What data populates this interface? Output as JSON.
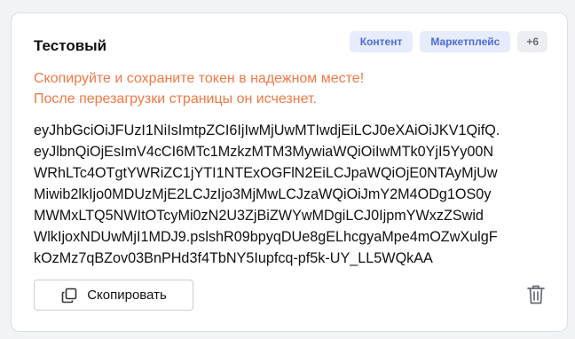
{
  "card": {
    "title": "Тестовый",
    "tags": [
      "Контент",
      "Маркетплейс"
    ],
    "more_tags": "+6",
    "warning_line1": "Скопируйте и сохраните токен в надежном месте!",
    "warning_line2": "После перезагрузки страницы он исчезнет.",
    "token_lines": [
      "eyJhbGciOiJFUzI1NiIsImtpZCI6IjIwMjUwMTIwdjEiLCJ0eXAiOiJKV1QifQ.",
      "eyJlbnQiOjEsImV4cCI6MTc1MzkzMTM3MywiaWQiOiIwMTk0YjI5Yy00N",
      "WRhLTc4OTgtYWRiZC1jYTI1NTExOGFlN2EiLCJpaWQiOjE0NTAyMjUw",
      "Miwib2lkIjo0MDUzMjE2LCJzIjo3MjMwLCJzaWQiOiJmY2M4ODg1OS0y",
      "MWMxLTQ5NWItOTcyMi0zN2U3ZjBiZWYwMDgiLCJ0IjpmYWxzZSwid",
      "WlkIjoxNDUwMjI1MDJ9.pslshR09bpyqDUe8gELhcgyaMpe4mOZwXulgF",
      "kOzMz7qBZov03BnPHd3f4TbNY5Iupfcq-pf5k-UY_LL5WQkAA"
    ],
    "copy_button_label": "Скопировать",
    "copy_icon": "copy-icon",
    "delete_icon": "trash-icon"
  },
  "colors": {
    "warning": "#f07845",
    "tag_bg": "#e6ecfb",
    "tag_text": "#4d6bd9"
  }
}
